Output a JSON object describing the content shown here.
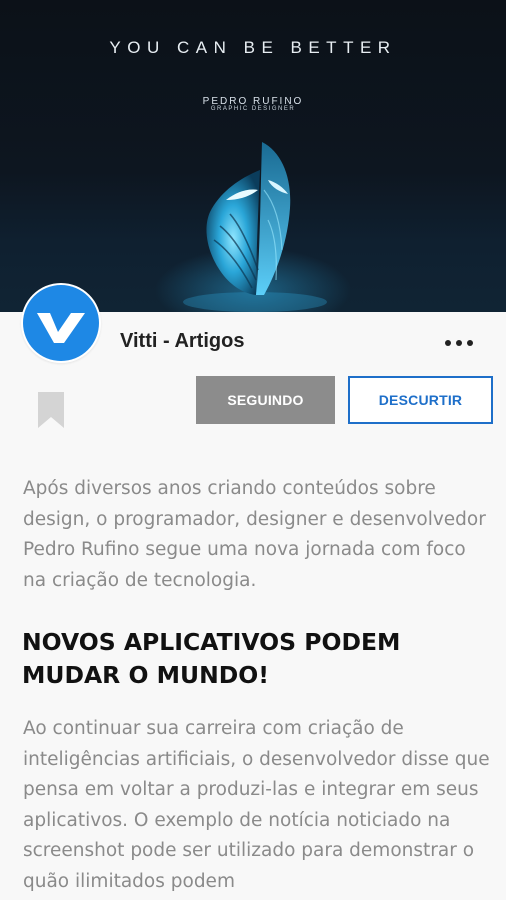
{
  "hero": {
    "title": "YOU CAN BE BETTER",
    "author_name": "PEDRO RUFINO",
    "author_role": "GRAPHIC DESIGNER",
    "image_icon": "butterfly-illustration"
  },
  "channel": {
    "name": "Vitti - Artigos",
    "avatar_icon": "vitti-logo-icon",
    "more_icon": "more-horizontal-icon",
    "bookmark_icon": "bookmark-icon"
  },
  "actions": {
    "following_label": "SEGUINDO",
    "dislike_label": "DESCURTIR"
  },
  "article": {
    "paragraph1": "Após diversos anos criando conteúdos sobre design, o programador, designer e desenvolvedor Pedro Rufino segue uma nova jornada com foco na criação de tecnologia.",
    "heading": "NOVOS APLICATIVOS PODEM MUDAR O MUNDO!",
    "paragraph2": "Ao continuar sua carreira com criação de inteligências artificiais, o desenvolvedor disse que pensa em voltar a produzi-las e integrar em seus aplicativos. O exemplo de notícia noticiado na screenshot pode ser utilizado para demonstrar o quão ilimitados podem"
  },
  "colors": {
    "accent": "#1e6fc9",
    "avatar_bg": "#1e88e5",
    "following_bg": "#8c8c8c",
    "body_text": "#8a8a8a",
    "hero_bg": "#0c1118"
  }
}
